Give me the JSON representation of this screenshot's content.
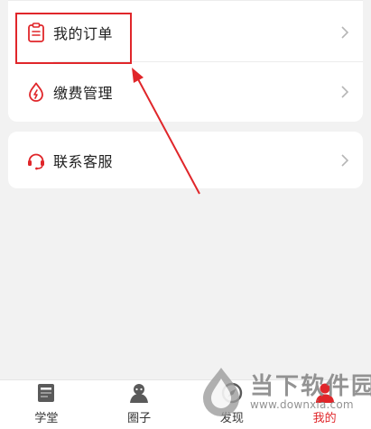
{
  "menu": {
    "items": [
      {
        "label": "我的订单",
        "icon": "clipboard-icon"
      },
      {
        "label": "缴费管理",
        "icon": "payment-drop-icon"
      }
    ],
    "support": {
      "label": "联系客服",
      "icon": "headset-icon"
    }
  },
  "annotation": {
    "highlight_color": "#e0262a"
  },
  "tabbar": {
    "active_color": "#e0262a",
    "tabs": [
      {
        "label": "学堂",
        "icon": "book-icon",
        "active": false
      },
      {
        "label": "圈子",
        "icon": "community-icon",
        "active": false
      },
      {
        "label": "发现",
        "icon": "discover-icon",
        "active": false
      },
      {
        "label": "我的",
        "icon": "profile-icon",
        "active": true
      }
    ]
  },
  "watermark": {
    "text": "当下软件园",
    "url": "www.downxia.com"
  },
  "colors": {
    "accent": "#e0262a",
    "background": "#f2f2f2",
    "card": "#ffffff"
  }
}
